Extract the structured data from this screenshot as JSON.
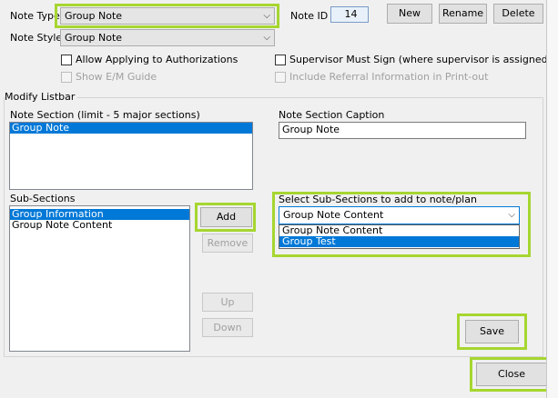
{
  "note_type": {
    "label": "Note Type",
    "value": "Group Note"
  },
  "note_id": {
    "label": "Note ID",
    "value": "14"
  },
  "toolbar": {
    "new": "New",
    "rename": "Rename",
    "delete": "Delete"
  },
  "note_style": {
    "label": "Note Style",
    "value": "Group Note"
  },
  "options": {
    "allow_auth": "Allow Applying to Authorizations",
    "show_em": "Show E/M Guide",
    "supervisor_sign": "Supervisor Must Sign (where supervisor is assigned)",
    "include_referral": "Include Referral Information in Print-out"
  },
  "group_title": "Modify Listbar",
  "note_section": {
    "label": "Note Section (limit - 5 major sections)",
    "items": [
      "Group Note"
    ]
  },
  "caption": {
    "label": "Note Section Caption",
    "value": "Group Note"
  },
  "sub_sections": {
    "label": "Sub-Sections",
    "items": [
      "Group Information",
      "Group Note Content"
    ]
  },
  "buttons": {
    "add": "Add",
    "remove": "Remove",
    "up": "Up",
    "down": "Down",
    "save": "Save",
    "close": "Close"
  },
  "select_sub": {
    "label": "Select Sub-Sections to add to note/plan",
    "value": "Group Note Content",
    "options": [
      "Group Note Content",
      "Group Test"
    ]
  },
  "colors": {
    "highlight": "#a6d630",
    "selection": "#0078d7"
  }
}
